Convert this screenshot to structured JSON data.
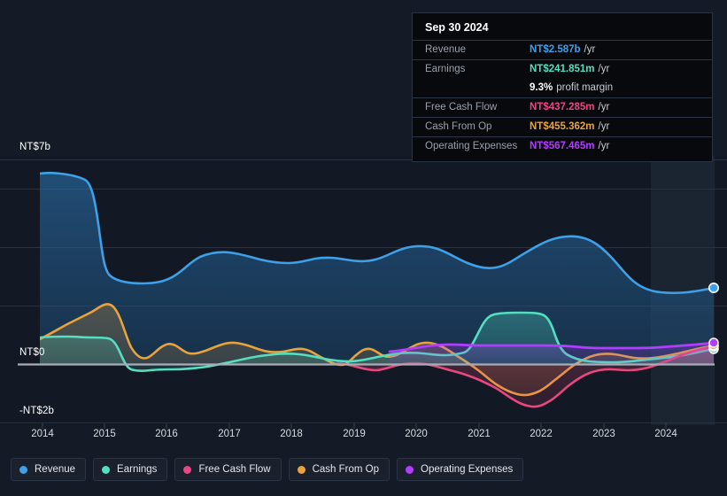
{
  "tooltip": {
    "date": "Sep 30 2024",
    "rows": [
      {
        "label": "Revenue",
        "value": "NT$2.587b",
        "suffix": "/yr",
        "color": "#3ea0e8"
      },
      {
        "label": "Earnings",
        "value": "NT$241.851m",
        "suffix": "/yr",
        "color": "#53dfc0"
      },
      {
        "label": "",
        "value": "9.3%",
        "suffix": "profit margin",
        "color": "#ffffff"
      },
      {
        "label": "Free Cash Flow",
        "value": "NT$437.285m",
        "suffix": "/yr",
        "color": "#e8487f"
      },
      {
        "label": "Cash From Op",
        "value": "NT$455.362m",
        "suffix": "/yr",
        "color": "#e8a33d"
      },
      {
        "label": "Operating Expenses",
        "value": "NT$567.465m",
        "suffix": "/yr",
        "color": "#b23cff"
      }
    ]
  },
  "legend": [
    {
      "label": "Revenue",
      "color": "#3ea0e8"
    },
    {
      "label": "Earnings",
      "color": "#53dfc0"
    },
    {
      "label": "Free Cash Flow",
      "color": "#e8487f"
    },
    {
      "label": "Cash From Op",
      "color": "#e8a33d"
    },
    {
      "label": "Operating Expenses",
      "color": "#b23cff"
    }
  ],
  "axis": {
    "y_top_label": "NT$7b",
    "y_zero_label": "NT$0",
    "y_bottom_label": "-NT$2b",
    "x_labels": [
      "2014",
      "2015",
      "2016",
      "2017",
      "2018",
      "2019",
      "2020",
      "2021",
      "2022",
      "2023",
      "2024"
    ]
  },
  "chart_data": {
    "type": "area",
    "title": "",
    "xlabel": "",
    "ylabel": "NT$",
    "ylim": [
      -2,
      7
    ],
    "grid": true,
    "legend_position": "bottom",
    "unit": "NT$ billions",
    "x": [
      "2014",
      "2015",
      "2016",
      "2017",
      "2018",
      "2019",
      "2020",
      "2021",
      "2022",
      "2023",
      "2024",
      "2024.75"
    ],
    "x_tick_labels": [
      "2014",
      "2015",
      "2016",
      "2017",
      "2018",
      "2019",
      "2020",
      "2021",
      "2022",
      "2023",
      "2024"
    ],
    "series": [
      {
        "name": "Revenue",
        "color": "#3ea0e8",
        "values": [
          6.52,
          3.82,
          4.1,
          4.0,
          3.93,
          3.76,
          4.2,
          3.83,
          4.45,
          3.15,
          2.5,
          2.587
        ]
      },
      {
        "name": "Earnings",
        "color": "#53dfc0",
        "values": [
          0.92,
          -0.18,
          -0.1,
          0.32,
          0.3,
          0.13,
          0.21,
          1.62,
          0.12,
          -0.02,
          0.16,
          0.2419
        ]
      },
      {
        "name": "Free Cash Flow",
        "color": "#e8487f",
        "values": [
          null,
          null,
          null,
          null,
          0.02,
          -0.18,
          -0.28,
          -0.6,
          -1.05,
          -0.18,
          0.27,
          0.4373
        ]
      },
      {
        "name": "Cash From Op",
        "color": "#e8a33d",
        "values": [
          1.1,
          1.7,
          0.3,
          0.56,
          0.55,
          -0.05,
          0.25,
          -0.3,
          -0.8,
          0.18,
          0.3,
          0.4554
        ]
      },
      {
        "name": "Operating Expenses",
        "color": "#b23cff",
        "values": [
          null,
          null,
          null,
          null,
          null,
          0.42,
          0.58,
          0.63,
          0.6,
          0.55,
          0.55,
          0.5675
        ]
      }
    ],
    "highlight_point": {
      "date": "Sep 30 2024",
      "revenue": 2.587,
      "earnings": 0.241851,
      "profit_margin_pct": 9.3,
      "free_cash_flow": 0.437285,
      "cash_from_op": 0.455362,
      "operating_expenses": 0.567465
    }
  }
}
